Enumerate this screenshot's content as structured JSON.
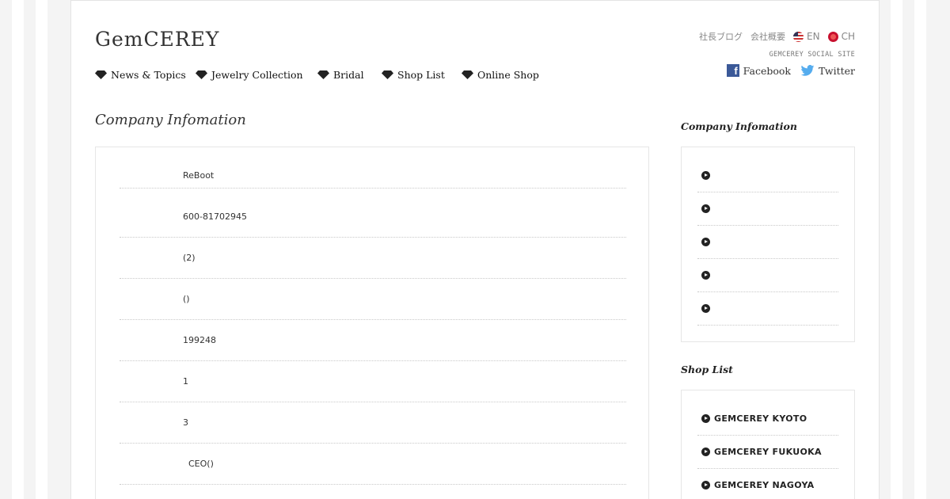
{
  "brand": {
    "logo_text": "GemCEREY"
  },
  "top_links": {
    "blog": "社長ブログ",
    "company": "会社概要",
    "en": "EN",
    "ch": "CH"
  },
  "social": {
    "caption": "GEMCEREY SOCIAL SITE",
    "facebook": "Facebook",
    "twitter": "Twitter"
  },
  "nav": [
    {
      "label": "News & Topics"
    },
    {
      "label": "Jewelry Collection"
    },
    {
      "label": "Bridal"
    },
    {
      "label": "Shop List"
    },
    {
      "label": "Online Shop"
    }
  ],
  "main": {
    "title": "Company Infomation",
    "rows": [
      {
        "value": "ReBoot"
      },
      {
        "value": "600-81702945"
      },
      {
        "value": "(2)"
      },
      {
        "value": "()"
      },
      {
        "value": "199248"
      },
      {
        "value": "1"
      },
      {
        "value": "3"
      },
      {
        "value": "  CEO()"
      }
    ]
  },
  "sidebar": {
    "company_title": "Company Infomation",
    "company_items": [
      {
        "label": ""
      },
      {
        "label": ""
      },
      {
        "label": ""
      },
      {
        "label": ""
      },
      {
        "label": ""
      }
    ],
    "shop_title": "Shop List",
    "shop_items": [
      {
        "label": "GEMCEREY KYOTO"
      },
      {
        "label": "GEMCEREY FUKUOKA"
      },
      {
        "label": "GEMCEREY NAGOYA"
      }
    ]
  },
  "colors": {
    "background": "#f4f4f4",
    "page": "#ffffff",
    "border": "#e6e6e6",
    "text": "#333333",
    "facebook": "#3b5998",
    "twitter": "#55acee"
  }
}
